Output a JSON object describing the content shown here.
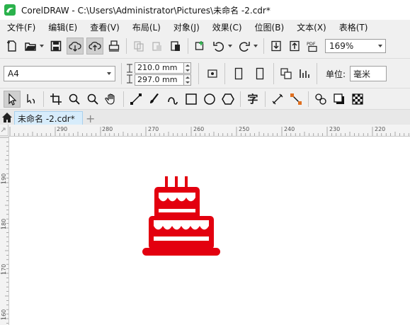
{
  "window": {
    "title": "CorelDRAW - C:\\Users\\Administrator\\Pictures\\未命名 -2.cdr*",
    "logo_color": "#2bb24c"
  },
  "menu": {
    "items": [
      "文件(F)",
      "编辑(E)",
      "查看(V)",
      "布局(L)",
      "对象(J)",
      "效果(C)",
      "位图(B)",
      "文本(X)",
      "表格(T)"
    ]
  },
  "standard_toolbar": {
    "icons": [
      "new-document-icon",
      "open-folder-icon",
      "save-icon",
      "cloud-download-icon",
      "cloud-upload-icon",
      "print-icon",
      "copy-icon",
      "paste-icon",
      "clipboard-icon",
      "search-content-icon",
      "undo-icon",
      "redo-icon",
      "import-icon",
      "export-icon",
      "export-pdf-icon"
    ],
    "pdf_label": "PDF",
    "zoom_value": "169%"
  },
  "property_bar": {
    "page_size": "A4",
    "width_value": "210.0 mm",
    "height_value": "297.0 mm",
    "units_label": "单位:",
    "units_value": "毫米",
    "icons": [
      "page-dimension-icon",
      "portrait-icon",
      "landscape-icon",
      "all-pages-icon",
      "current-page-icon"
    ]
  },
  "toolbox": {
    "icons": [
      "pick-tool-icon",
      "shape-tool-icon",
      "crop-tool-icon",
      "zoom-tool-icon",
      "zoom-out-icon",
      "pan-tool-icon",
      "freehand-tool-icon",
      "artistic-media-icon",
      "bezier-tool-icon",
      "rectangle-tool-icon",
      "ellipse-tool-icon",
      "polygon-tool-icon",
      "text-tool-icon",
      "dimension-tool-icon",
      "connector-tool-icon",
      "blend-tool-icon",
      "shadow-tool-icon",
      "transparency-tool-icon"
    ],
    "text_tool_glyph": "字"
  },
  "document_tab": {
    "label": "未命名 -2.cdr*",
    "add_label": "+"
  },
  "horizontal_ruler": {
    "unit": "毫米",
    "labels": [
      "290",
      "280",
      "270",
      "260",
      "250",
      "240",
      "230",
      "220"
    ]
  },
  "vertical_ruler": {
    "labels": [
      "190",
      "180",
      "170",
      "160"
    ]
  },
  "canvas": {
    "object": "birthday-cake-icon",
    "object_color": "#e3000f"
  }
}
